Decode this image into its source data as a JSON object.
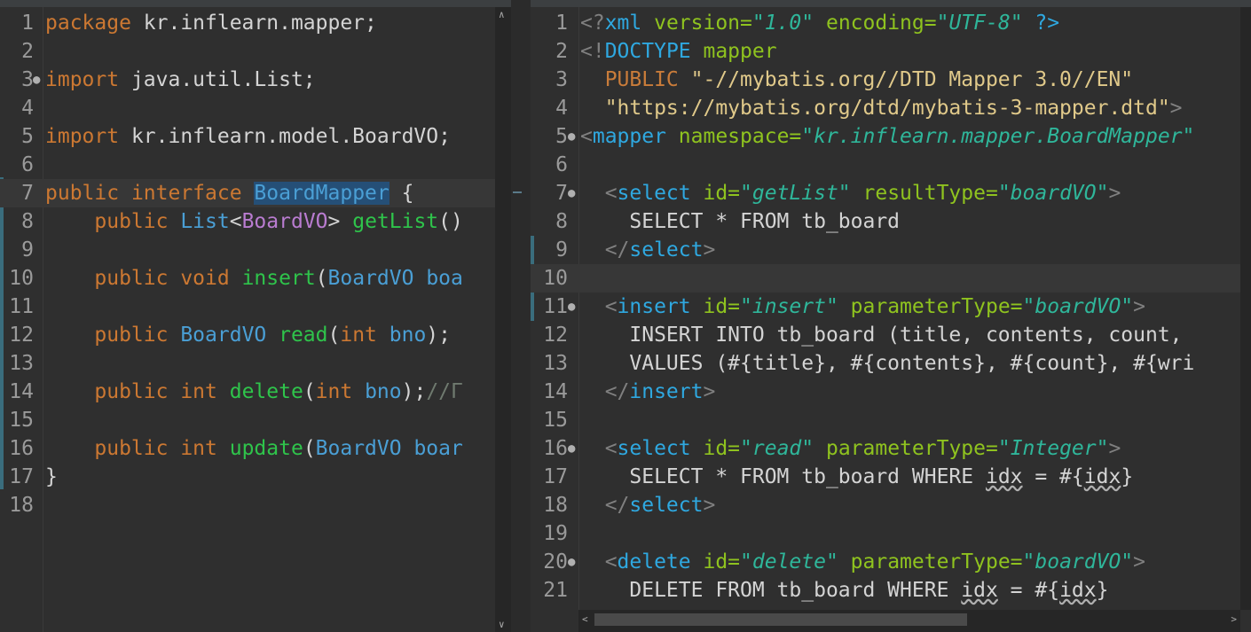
{
  "left_editor": {
    "lines": [
      {
        "n": "1",
        "tokens": [
          {
            "t": "package ",
            "c": "kw"
          },
          {
            "t": "kr.inflearn.mapper;",
            "c": ""
          }
        ]
      },
      {
        "n": "2",
        "tokens": []
      },
      {
        "n": "3",
        "fold": true,
        "tokens": [
          {
            "t": "import ",
            "c": "kw"
          },
          {
            "t": "java.util.List;",
            "c": ""
          }
        ]
      },
      {
        "n": "4",
        "tokens": []
      },
      {
        "n": "5",
        "tokens": [
          {
            "t": "import ",
            "c": "kw"
          },
          {
            "t": "kr.inflearn.model.BoardVO;",
            "c": ""
          }
        ]
      },
      {
        "n": "6",
        "tokens": []
      },
      {
        "n": "7",
        "tokens": [
          {
            "t": "public ",
            "c": "kw"
          },
          {
            "t": "interface ",
            "c": "kw"
          },
          {
            "t": "BoardMapper",
            "c": "ty sel"
          },
          {
            "t": " {",
            "c": ""
          }
        ]
      },
      {
        "n": "8",
        "tokens": [
          {
            "t": "    public ",
            "c": "kw"
          },
          {
            "t": "List",
            "c": "ty"
          },
          {
            "t": "<",
            "c": ""
          },
          {
            "t": "BoardVO",
            "c": "gn"
          },
          {
            "t": "> ",
            "c": ""
          },
          {
            "t": "getList",
            "c": "fn"
          },
          {
            "t": "()",
            "c": ""
          }
        ]
      },
      {
        "n": "9",
        "tokens": []
      },
      {
        "n": "10",
        "tokens": [
          {
            "t": "    public ",
            "c": "kw"
          },
          {
            "t": "void ",
            "c": "kw"
          },
          {
            "t": "insert",
            "c": "fn"
          },
          {
            "t": "(",
            "c": ""
          },
          {
            "t": "BoardVO ",
            "c": "ty"
          },
          {
            "t": "boa",
            "c": "ty"
          }
        ]
      },
      {
        "n": "11",
        "tokens": []
      },
      {
        "n": "12",
        "tokens": [
          {
            "t": "    public ",
            "c": "kw"
          },
          {
            "t": "BoardVO ",
            "c": "ty"
          },
          {
            "t": "read",
            "c": "fn"
          },
          {
            "t": "(",
            "c": ""
          },
          {
            "t": "int ",
            "c": "kw"
          },
          {
            "t": "bno",
            "c": "ty"
          },
          {
            "t": ");",
            "c": ""
          }
        ]
      },
      {
        "n": "13",
        "tokens": []
      },
      {
        "n": "14",
        "tokens": [
          {
            "t": "    public ",
            "c": "kw"
          },
          {
            "t": "int ",
            "c": "kw"
          },
          {
            "t": "delete",
            "c": "fn"
          },
          {
            "t": "(",
            "c": ""
          },
          {
            "t": "int ",
            "c": "kw"
          },
          {
            "t": "bno",
            "c": "ty"
          },
          {
            "t": ");",
            "c": ""
          },
          {
            "t": "//Γ",
            "c": "cm"
          }
        ]
      },
      {
        "n": "15",
        "tokens": []
      },
      {
        "n": "16",
        "tokens": [
          {
            "t": "    public ",
            "c": "kw"
          },
          {
            "t": "int ",
            "c": "kw"
          },
          {
            "t": "update",
            "c": "fn"
          },
          {
            "t": "(",
            "c": ""
          },
          {
            "t": "BoardVO ",
            "c": "ty"
          },
          {
            "t": "boar",
            "c": "ty"
          }
        ]
      },
      {
        "n": "17",
        "tokens": [
          {
            "t": "}",
            "c": ""
          }
        ]
      },
      {
        "n": "18",
        "tokens": []
      }
    ]
  },
  "right_editor": {
    "lines": [
      {
        "n": "1",
        "tokens": [
          {
            "t": "<?",
            "c": "xb"
          },
          {
            "t": "xml ",
            "c": "xt"
          },
          {
            "t": "version=",
            "c": "xa"
          },
          {
            "t": "\"1.0\"",
            "c": "xv"
          },
          {
            "t": " encoding=",
            "c": "xa"
          },
          {
            "t": "\"UTF-8\"",
            "c": "xv"
          },
          {
            "t": " ?>",
            "c": "xt"
          }
        ]
      },
      {
        "n": "2",
        "tokens": [
          {
            "t": "<!",
            "c": "xb"
          },
          {
            "t": "DOCTYPE ",
            "c": "xt"
          },
          {
            "t": "mapper",
            "c": "xa"
          }
        ]
      },
      {
        "n": "3",
        "tokens": [
          {
            "t": "  PUBLIC ",
            "c": "xp"
          },
          {
            "t": "\"-//mybatis.org//DTD Mapper 3.0//EN\"",
            "c": "xs"
          }
        ]
      },
      {
        "n": "4",
        "tokens": [
          {
            "t": "  \"https://mybatis.org/dtd/mybatis-3-mapper.dtd\"",
            "c": "xs"
          },
          {
            "t": ">",
            "c": "xb"
          }
        ]
      },
      {
        "n": "5",
        "fold": true,
        "tokens": [
          {
            "t": "<",
            "c": "xb"
          },
          {
            "t": "mapper ",
            "c": "xt"
          },
          {
            "t": "namespace=",
            "c": "xa"
          },
          {
            "t": "\"kr.inflearn.mapper.BoardMapper\"",
            "c": "xv"
          }
        ]
      },
      {
        "n": "6",
        "tokens": []
      },
      {
        "n": "7",
        "fold": true,
        "tokens": [
          {
            "t": "  <",
            "c": "xb"
          },
          {
            "t": "select ",
            "c": "xt"
          },
          {
            "t": "id=",
            "c": "xa"
          },
          {
            "t": "\"getList\"",
            "c": "xv"
          },
          {
            "t": " resultType=",
            "c": "xa"
          },
          {
            "t": "\"boardVO\"",
            "c": "xv"
          },
          {
            "t": ">",
            "c": "xb"
          }
        ]
      },
      {
        "n": "8",
        "tokens": [
          {
            "t": "    SELECT * FROM tb_board",
            "c": ""
          }
        ]
      },
      {
        "n": "9",
        "tokens": [
          {
            "t": "  </",
            "c": "xb"
          },
          {
            "t": "select",
            "c": "xt"
          },
          {
            "t": ">",
            "c": "xb"
          }
        ]
      },
      {
        "n": "10",
        "tokens": []
      },
      {
        "n": "11",
        "fold": true,
        "tokens": [
          {
            "t": "  <",
            "c": "xb"
          },
          {
            "t": "insert ",
            "c": "xt"
          },
          {
            "t": "id=",
            "c": "xa"
          },
          {
            "t": "\"insert\"",
            "c": "xv"
          },
          {
            "t": " parameterType=",
            "c": "xa"
          },
          {
            "t": "\"boardVO\"",
            "c": "xv"
          },
          {
            "t": ">",
            "c": "xb"
          }
        ]
      },
      {
        "n": "12",
        "tokens": [
          {
            "t": "    INSERT INTO tb_board (title, contents, count, ",
            "c": ""
          }
        ]
      },
      {
        "n": "13",
        "tokens": [
          {
            "t": "    VALUES (#{title}, #{contents}, #{count}, #{wri",
            "c": ""
          }
        ]
      },
      {
        "n": "14",
        "tokens": [
          {
            "t": "  </",
            "c": "xb"
          },
          {
            "t": "insert",
            "c": "xt"
          },
          {
            "t": ">",
            "c": "xb"
          }
        ]
      },
      {
        "n": "15",
        "tokens": []
      },
      {
        "n": "16",
        "fold": true,
        "tokens": [
          {
            "t": "  <",
            "c": "xb"
          },
          {
            "t": "select ",
            "c": "xt"
          },
          {
            "t": "id=",
            "c": "xa"
          },
          {
            "t": "\"read\"",
            "c": "xv"
          },
          {
            "t": " parameterType=",
            "c": "xa"
          },
          {
            "t": "\"Integer\"",
            "c": "xv"
          },
          {
            "t": ">",
            "c": "xb"
          }
        ]
      },
      {
        "n": "17",
        "tokens": [
          {
            "t": "    SELECT * FROM tb_board WHERE ",
            "c": ""
          },
          {
            "t": "idx",
            "c": "sq"
          },
          {
            "t": " = #{",
            "c": ""
          },
          {
            "t": "idx",
            "c": "sq"
          },
          {
            "t": "}",
            "c": ""
          }
        ]
      },
      {
        "n": "18",
        "tokens": [
          {
            "t": "  </",
            "c": "xb"
          },
          {
            "t": "select",
            "c": "xt"
          },
          {
            "t": ">",
            "c": "xb"
          }
        ]
      },
      {
        "n": "19",
        "tokens": []
      },
      {
        "n": "20",
        "fold": true,
        "tokens": [
          {
            "t": "  <",
            "c": "xb"
          },
          {
            "t": "delete ",
            "c": "xt"
          },
          {
            "t": "id=",
            "c": "xa"
          },
          {
            "t": "\"delete\"",
            "c": "xv"
          },
          {
            "t": " parameterType=",
            "c": "xa"
          },
          {
            "t": "\"boardVO\"",
            "c": "xv"
          },
          {
            "t": ">",
            "c": "xb"
          }
        ]
      },
      {
        "n": "21",
        "tokens": [
          {
            "t": "    DELETE FROM tb_board WHERE ",
            "c": ""
          },
          {
            "t": "idx",
            "c": "sq"
          },
          {
            "t": " = #{",
            "c": ""
          },
          {
            "t": "idx",
            "c": "sq"
          },
          {
            "t": "}",
            "c": ""
          }
        ]
      }
    ]
  },
  "icons": {
    "fold": "fold-collapse-icon",
    "scroll_up": "scroll-up-arrow-icon",
    "scroll_down": "scroll-down-arrow-icon",
    "scroll_left": "scroll-left-arrow-icon",
    "scroll_right": "scroll-right-arrow-icon"
  },
  "colors": {
    "background": "#2f2f2f",
    "keyword": "#cc7832",
    "type": "#4a9fd5",
    "method": "#2fc44b",
    "generic": "#b97cd0",
    "xml_tag": "#2fa8e0",
    "xml_attr": "#8fc31f",
    "xml_value": "#2fb69a",
    "selection": "#254f77"
  }
}
